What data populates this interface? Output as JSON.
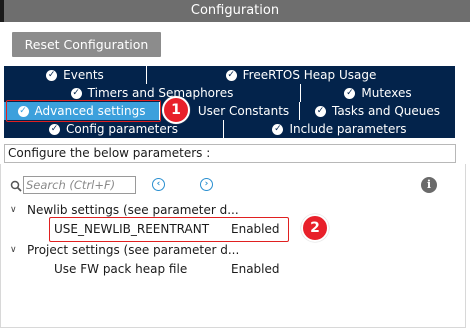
{
  "window": {
    "title": "Configuration"
  },
  "toolbar": {
    "reset_label": "Reset Configuration"
  },
  "tabs": {
    "row1": [
      {
        "label": "Events",
        "active": false
      },
      {
        "label": "FreeRTOS Heap Usage",
        "active": false
      }
    ],
    "row2": [
      {
        "label": "Timers and Semaphores",
        "active": false
      },
      {
        "label": "Mutexes",
        "active": false
      }
    ],
    "row3": [
      {
        "label": "Advanced settings",
        "active": true
      },
      {
        "label": "User Constants",
        "active": false
      },
      {
        "label": "Tasks and Queues",
        "active": false
      }
    ],
    "row4": [
      {
        "label": "Config parameters",
        "active": false
      },
      {
        "label": "Include parameters",
        "active": false
      }
    ]
  },
  "info": {
    "text": "Configure the below parameters :"
  },
  "search": {
    "placeholder": "Search (Ctrl+F)"
  },
  "tree": {
    "groups": [
      {
        "label": "Newlib settings (see parameter d...",
        "params": [
          {
            "name": "USE_NEWLIB_REENTRANT",
            "value": "Enabled"
          }
        ]
      },
      {
        "label": "Project settings (see parameter d...",
        "params": [
          {
            "name": "Use FW pack heap file",
            "value": "Enabled"
          }
        ]
      }
    ]
  },
  "annotations": [
    {
      "number": "1"
    },
    {
      "number": "2"
    }
  ],
  "colors": {
    "tab_bg": "#03234b",
    "tab_active_bg": "#3ca0dc",
    "title_bg": "#6e6e6e",
    "button_bg": "#8c8c8c",
    "annotation_red": "#e8202a",
    "nav_blue": "#2a8fd0"
  },
  "icons": {
    "tab_check": "check-circle-icon",
    "search": "search-icon",
    "prev": "chevron-left-circle-icon",
    "next": "chevron-right-circle-icon",
    "info": "info-icon",
    "expand": "chevron-down-icon"
  }
}
